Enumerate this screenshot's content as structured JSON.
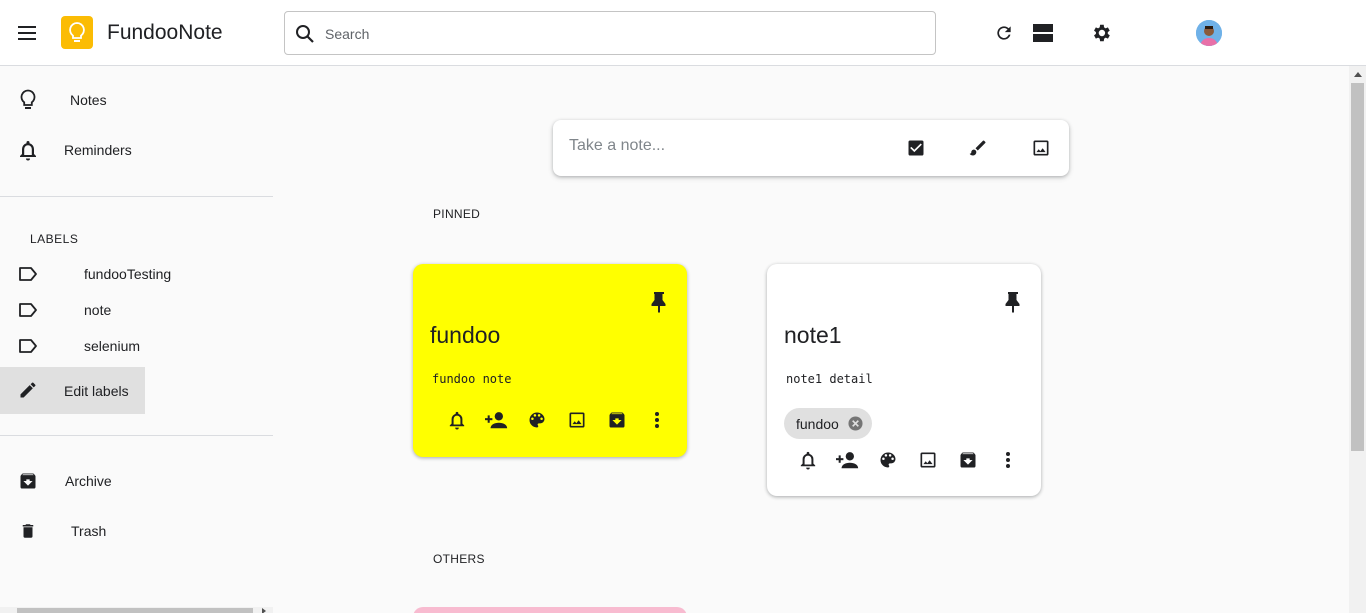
{
  "app": {
    "title": "FundooNote"
  },
  "search": {
    "placeholder": "Search",
    "value": ""
  },
  "header_icons": [
    "menu-icon",
    "bulb-icon",
    "search-icon",
    "refresh-icon",
    "list-view-icon",
    "settings-icon",
    "avatar"
  ],
  "sidebar": {
    "items": [
      {
        "label": "Notes",
        "icon": "bulb-icon"
      },
      {
        "label": "Reminders",
        "icon": "bell-icon"
      }
    ],
    "labels_heading": "LABELS",
    "labels": [
      {
        "label": "fundooTesting",
        "icon": "label-icon"
      },
      {
        "label": "note",
        "icon": "label-icon"
      },
      {
        "label": "selenium",
        "icon": "label-icon"
      }
    ],
    "edit_labels": {
      "label": "Edit labels",
      "icon": "pencil-icon"
    },
    "bottom_items": [
      {
        "label": "Archive",
        "icon": "archive-icon"
      },
      {
        "label": "Trash",
        "icon": "trash-icon"
      }
    ]
  },
  "take_note": {
    "placeholder": "Take a note...",
    "icons": [
      "checkbox-icon",
      "brush-icon",
      "image-icon"
    ]
  },
  "sections": {
    "pinned": "PINNED",
    "others": "OTHERS"
  },
  "notes": [
    {
      "title": "fundoo",
      "description": "fundoo note",
      "color": "#ffff00",
      "pinned": true,
      "labels": []
    },
    {
      "title": "note1",
      "description": "note1 detail",
      "color": "#ffffff",
      "pinned": true,
      "labels": [
        "fundoo"
      ]
    }
  ],
  "note_action_icons": [
    "bell-icon",
    "add-person-icon",
    "palette-icon",
    "image-icon",
    "archive-icon",
    "more-vert-icon"
  ],
  "colors": {
    "accent": "#fbbc04",
    "active_nav": "#e0e0e0",
    "others_note_color": "#f8bbd0"
  }
}
